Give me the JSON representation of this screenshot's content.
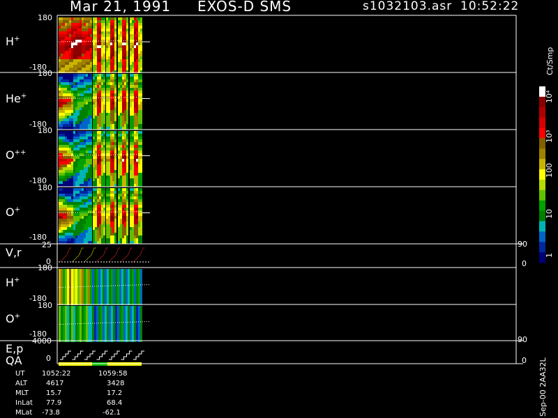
{
  "header": {
    "date": "Mar 21, 1991",
    "instrument": "EXOS-D SMS",
    "file": "s1032103.asr",
    "time": "10:52:22"
  },
  "panels": [
    {
      "label": "H",
      "sup": "+",
      "top": "180",
      "bottom": "-180"
    },
    {
      "label": "He",
      "sup": "+",
      "top": "180",
      "bottom": "-180"
    },
    {
      "label": "O",
      "sup": "++",
      "top": "180",
      "bottom": "-180"
    },
    {
      "label": "O",
      "sup": "+",
      "top": "180",
      "bottom": "-180"
    },
    {
      "label": "V,r",
      "sup": "",
      "top": "25",
      "bottom": "0",
      "right_top": "90",
      "right_bottom": "0"
    },
    {
      "label": "H",
      "sup": "+",
      "top": "180",
      "bottom": "-180"
    },
    {
      "label": "O",
      "sup": "+",
      "top": "180",
      "bottom": "-180"
    },
    {
      "label": "E,p",
      "sup": "",
      "top": "4000",
      "bottom": "0",
      "right_top": "90",
      "right_bottom": "0"
    }
  ],
  "qa_label": "QA",
  "colorbar": {
    "unit": "Ct/Smp",
    "labels": [
      "10⁴",
      "10³",
      "100",
      "10",
      "1"
    ],
    "colors": [
      "#ffffff",
      "#8b0000",
      "#b00000",
      "#d40000",
      "#ff0000",
      "#806000",
      "#a08000",
      "#c8b400",
      "#ffff00",
      "#b4dc00",
      "#60c000",
      "#00a000",
      "#008000",
      "#00b4b4",
      "#0064c8",
      "#0028a0",
      "#000078"
    ]
  },
  "info_table": {
    "rows": [
      {
        "label": "UT",
        "v1": "1052:22",
        "v2": "1059:58"
      },
      {
        "label": "ALT",
        "v1": "4617",
        "v2": "3428"
      },
      {
        "label": "MLT",
        "v1": "15.7",
        "v2": "17.2"
      },
      {
        "label": "InLat",
        "v1": "77.9",
        "v2": "68.4"
      },
      {
        "label": "MLat",
        "v1": "-73.8",
        "v2": "-62.1"
      }
    ]
  },
  "footer_right": "Sep-00 2AA32L",
  "chart_data": {
    "type": "heatmap",
    "title": "Mar 21, 1991 EXOS-D SMS",
    "colorbar_label": "Ct/Smp",
    "colorbar_ticks": [
      "1",
      "10",
      "100",
      "10³",
      "10⁴"
    ],
    "pitch_angle_panels": [
      "H+",
      "He+",
      "O++",
      "O+"
    ],
    "pitch_angle_range": [
      -180,
      180
    ],
    "velocity_panel": {
      "label": "V,r",
      "ylim": [
        0,
        25
      ],
      "right_ylim": [
        0,
        90
      ]
    },
    "composition_panels": [
      "H+",
      "O+"
    ],
    "energy_panel": {
      "label": "E,p",
      "ylim": [
        0,
        4000
      ],
      "right_ylim": [
        0,
        90
      ]
    },
    "time_axis": {
      "start": "1052:22",
      "end": "1059:58"
    },
    "orbit": {
      "ALT": [
        4617,
        3428
      ],
      "MLT": [
        15.7,
        17.2
      ],
      "InLat": [
        77.9,
        68.4
      ],
      "MLat": [
        -73.8,
        -62.1
      ]
    }
  }
}
